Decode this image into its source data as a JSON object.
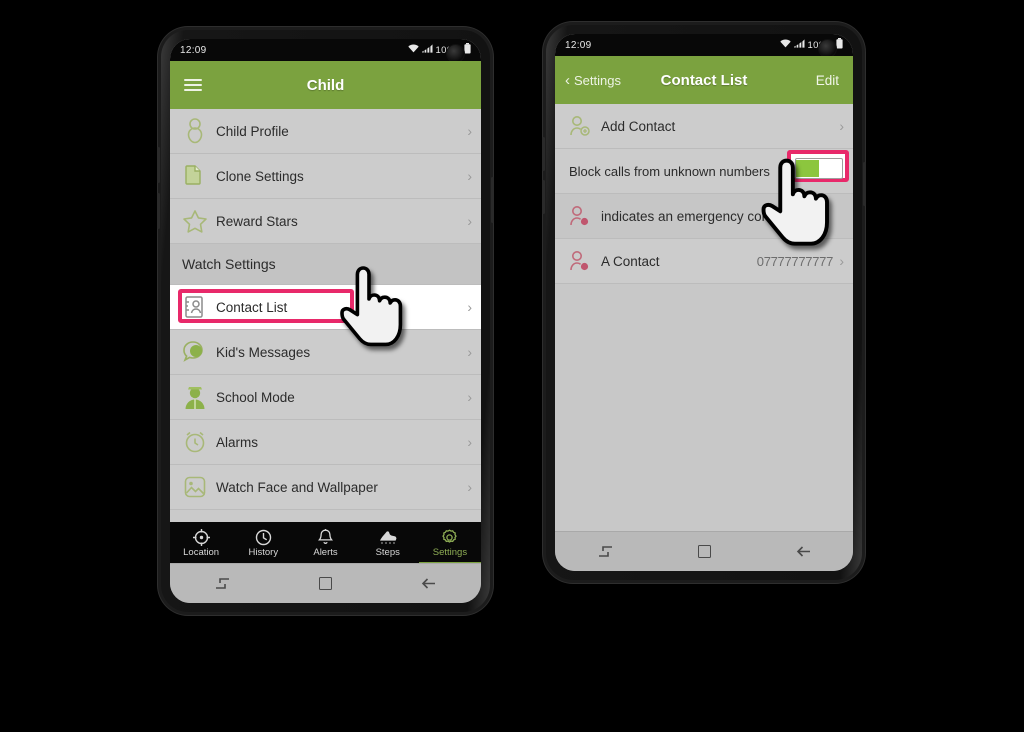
{
  "background_color": "#000000",
  "accent": {
    "green": "#7ba23f",
    "pink": "#e8296a",
    "toggle_green": "#8cc63e"
  },
  "status_bar": {
    "time": "12:09",
    "battery": "100%",
    "wifi_icon": "wifi-icon",
    "signal_icon": "signal-icon",
    "battery_icon": "battery-icon"
  },
  "left_phone": {
    "header": {
      "menu_icon": "hamburger-menu-icon",
      "title": "Child"
    },
    "items": [
      {
        "icon": "child-profile-icon",
        "label": "Child Profile",
        "chevron": "›"
      },
      {
        "icon": "clone-settings-icon",
        "label": "Clone Settings",
        "chevron": "›"
      },
      {
        "icon": "reward-stars-icon",
        "label": "Reward Stars",
        "chevron": "›"
      }
    ],
    "section_header": "Watch Settings",
    "watch_items": [
      {
        "icon": "contact-list-icon",
        "label": "Contact List",
        "chevron": "›",
        "highlighted": true
      },
      {
        "icon": "kids-messages-icon",
        "label": "Kid's Messages",
        "chevron": "›"
      },
      {
        "icon": "school-mode-icon",
        "label": "School Mode",
        "chevron": "›"
      },
      {
        "icon": "alarms-icon",
        "label": "Alarms",
        "chevron": "›"
      },
      {
        "icon": "watch-face-icon",
        "label": "Watch Face and Wallpaper",
        "chevron": "›"
      }
    ],
    "tabs": [
      {
        "icon": "location-icon",
        "label": "Location",
        "active": false
      },
      {
        "icon": "history-clock-icon",
        "label": "History",
        "active": false
      },
      {
        "icon": "alerts-bell-icon",
        "label": "Alerts",
        "active": false
      },
      {
        "icon": "steps-shoe-icon",
        "label": "Steps",
        "active": false
      },
      {
        "icon": "settings-gear-icon",
        "label": "Settings",
        "active": true
      }
    ]
  },
  "right_phone": {
    "header": {
      "back_label": "Settings",
      "back_icon": "chevron-left-icon",
      "title": "Contact List",
      "edit_label": "Edit"
    },
    "items": [
      {
        "icon": "add-contact-icon",
        "label": "Add Contact",
        "value": "",
        "chevron": "›"
      },
      {
        "icon": "",
        "label": "Block calls from unknown numbers",
        "value": "",
        "chevron": "",
        "toggle": true,
        "toggle_on": true,
        "highlighted": true
      },
      {
        "icon": "emergency-contact-icon",
        "label": "indicates an emergency contact",
        "value": "",
        "chevron": ""
      },
      {
        "icon": "emergency-contact-icon",
        "label": "A Contact",
        "value": "07777777777",
        "chevron": "›"
      }
    ]
  },
  "android_nav": {
    "recents_icon": "recents-icon",
    "home_icon": "home-square-icon",
    "back_icon": "back-arrow-icon"
  },
  "cursors": [
    {
      "name": "hand-cursor-left",
      "target": "contact-list-row"
    },
    {
      "name": "hand-cursor-right",
      "target": "block-calls-toggle"
    }
  ]
}
